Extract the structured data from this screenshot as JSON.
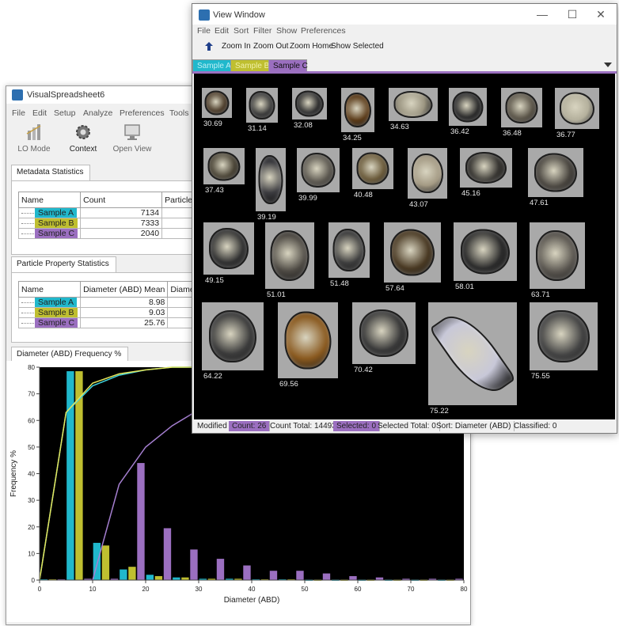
{
  "colors": {
    "sample_a": "#20b8cc",
    "sample_b": "#bfbf30",
    "sample_c": "#9b6fc0",
    "plot_bg": "#000000"
  },
  "vs": {
    "title": "VisualSpreadsheet6",
    "menu": [
      "File",
      "Edit",
      "Setup",
      "Analyze",
      "Preferences",
      "Tools"
    ],
    "toolbar": [
      {
        "label": "LO Mode",
        "icon": "lo-mode-icon"
      },
      {
        "label": "Context",
        "icon": "gear-icon"
      },
      {
        "label": "Open View",
        "icon": "monitor-icon"
      }
    ],
    "metadata_tab": "Metadata Statistics",
    "metadata_headers": [
      "Name",
      "Count",
      "Particles /"
    ],
    "metadata_rows": [
      {
        "name": "Sample A",
        "count": "7134"
      },
      {
        "name": "Sample B",
        "count": "7333"
      },
      {
        "name": "Sample C",
        "count": "2040"
      }
    ],
    "property_tab": "Particle Property Statistics",
    "property_headers": [
      "Name",
      "Diameter (ABD) Mean",
      "Diameter"
    ],
    "property_rows": [
      {
        "name": "Sample A",
        "mean": "8.98"
      },
      {
        "name": "Sample B",
        "mean": "9.03"
      },
      {
        "name": "Sample C",
        "mean": "25.76"
      }
    ],
    "chart_tab": "Diameter (ABD) Frequency %"
  },
  "chart_data": {
    "type": "bar",
    "title": "Diameter (ABD) Frequency %",
    "xlabel": "Diameter (ABD)",
    "ylabel": "Frequency %",
    "xlim": [
      0,
      80
    ],
    "ylim": [
      0,
      80
    ],
    "x_ticks": [
      0,
      10,
      20,
      30,
      40,
      50,
      60,
      70,
      80
    ],
    "y_ticks": [
      0,
      10,
      20,
      30,
      40,
      50,
      60,
      70,
      80
    ],
    "bin_centers": [
      2.5,
      7.5,
      12.5,
      17.5,
      22.5,
      27.5,
      32.5,
      37.5,
      42.5,
      47.5,
      52.5,
      57.5,
      62.5,
      67.5,
      72.5,
      77.5
    ],
    "series": [
      {
        "name": "Sample A",
        "values": [
          0.3,
          78.5,
          14,
          4,
          2,
          1,
          0.5,
          0.5,
          0.3,
          0.3,
          0.2,
          0.2,
          0.2,
          0.2,
          0.2,
          0.2
        ]
      },
      {
        "name": "Sample B",
        "values": [
          0.3,
          78.5,
          13,
          5,
          1.5,
          1,
          0.5,
          0.5,
          0.3,
          0.3,
          0.2,
          0.2,
          0.2,
          0.2,
          0.2,
          0.2
        ]
      },
      {
        "name": "Sample C",
        "values": [
          0.3,
          0.5,
          0.5,
          44,
          19.5,
          11.5,
          8,
          5.5,
          3.5,
          3.5,
          2.5,
          1.5,
          1,
          0.5,
          0.5,
          0.5
        ]
      }
    ],
    "cumulative": [
      {
        "name": "Sample A",
        "x": [
          0,
          5,
          10,
          15,
          20,
          25,
          30
        ],
        "y": [
          0,
          63,
          73,
          77,
          79,
          80,
          80
        ]
      },
      {
        "name": "Sample B",
        "x": [
          0,
          5,
          10,
          15,
          20,
          25,
          30
        ],
        "y": [
          0,
          63,
          74,
          77.5,
          79,
          80,
          80
        ]
      },
      {
        "name": "Sample C",
        "x": [
          10,
          15,
          20,
          25,
          30,
          32
        ],
        "y": [
          0,
          36,
          50,
          58,
          64,
          66
        ]
      }
    ],
    "grid": false,
    "legend": "none"
  },
  "vw": {
    "title": "View Window",
    "controls": [
      "—",
      "☐",
      "✕"
    ],
    "menu": [
      "File",
      "Edit",
      "Sort",
      "Filter",
      "Show",
      "Preferences"
    ],
    "toolbar": [
      "Zoom In",
      "Zoom Out",
      "Zoom Home",
      "Show Selected"
    ],
    "tabs": [
      "Sample A",
      "Sample B",
      "Sample C"
    ],
    "active_tab": "Sample C",
    "particle_labels": [
      "30.69",
      "31.14",
      "32.08",
      "34.25",
      "34.63",
      "36.42",
      "36.48",
      "36.77",
      "37.43",
      "39.19",
      "39.99",
      "40.48",
      "43.07",
      "45.16",
      "47.61",
      "49.15",
      "51.01",
      "51.48",
      "57.64",
      "58.01",
      "63.71",
      "64.22",
      "69.56",
      "70.42",
      "75.22",
      "75.55"
    ],
    "status": {
      "mode": "Modified",
      "count": "Count: 26",
      "count_total": "Count Total: 14493",
      "selected": "Selected: 0",
      "selected_total": "Selected Total: 0",
      "sort": "Sort: Diameter (ABD)",
      "classified": "Classified: 0"
    }
  }
}
